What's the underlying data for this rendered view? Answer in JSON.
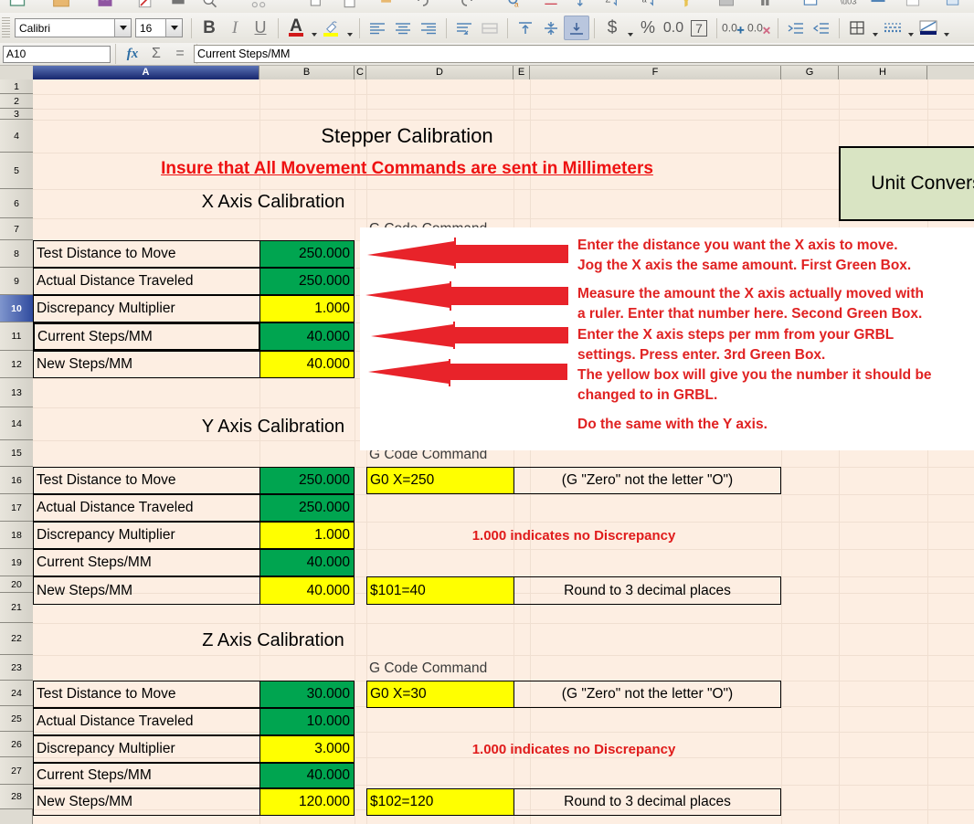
{
  "toolbar": {
    "font_name": "Calibri",
    "font_size": "16",
    "bold_label": "B",
    "italic_label": "I",
    "underline_label": "U",
    "font_color_label": "A",
    "highlight_label": "highlighting-color-icon",
    "currency_label": "$",
    "percent_label": "%",
    "number_label": "0.0",
    "date_label": "7",
    "add_decimal_label": "0.0+",
    "del_decimal_label": "0.0x",
    "icons": [
      "align-left-icon",
      "align-center-icon",
      "align-right-icon",
      "align-justified-icon",
      "wrap-text-icon",
      "merge-cells-icon",
      "align-top-icon",
      "center-vertically-icon",
      "align-bottom-icon",
      "increase-indent-icon",
      "decrease-indent-icon",
      "borders-icon",
      "border-style-icon",
      "border-color-icon"
    ]
  },
  "formula_bar": {
    "name_box": "A10",
    "function_wizard": "fx",
    "sum_icon": "Σ",
    "formula_icon": "=",
    "input_line": "Current Steps/MM"
  },
  "grid": {
    "columns": [
      {
        "label": "A",
        "selected": true
      },
      {
        "label": "B",
        "selected": false
      },
      {
        "label": "C",
        "selected": false
      },
      {
        "label": "D",
        "selected": false
      },
      {
        "label": "E",
        "selected": false
      },
      {
        "label": "F",
        "selected": false
      },
      {
        "label": "G",
        "selected": false
      },
      {
        "label": "H",
        "selected": false
      }
    ],
    "rows": [
      {
        "label": "1"
      },
      {
        "label": "2"
      },
      {
        "label": "3"
      },
      {
        "label": "4"
      },
      {
        "label": "5"
      },
      {
        "label": "6"
      },
      {
        "label": "7"
      },
      {
        "label": "8"
      },
      {
        "label": "9"
      },
      {
        "label": "10",
        "selected": true
      },
      {
        "label": "11"
      },
      {
        "label": "12"
      },
      {
        "label": "13"
      },
      {
        "label": "14"
      },
      {
        "label": "15"
      },
      {
        "label": "16"
      },
      {
        "label": "17"
      },
      {
        "label": "18"
      },
      {
        "label": "19"
      },
      {
        "label": "20"
      },
      {
        "label": "21"
      },
      {
        "label": "22"
      },
      {
        "label": "23"
      },
      {
        "label": "24"
      },
      {
        "label": "25"
      },
      {
        "label": "26"
      },
      {
        "label": "27"
      },
      {
        "label": "28"
      }
    ]
  },
  "sheet": {
    "heading_main": "Stepper Calibration",
    "warning": "Insure that All Movement Commands are sent in Millimeters",
    "unit_conversion_title": "Unit Conversion",
    "sections": [
      {
        "title": "X Axis Calibration",
        "gcode_header": "G Code Command",
        "rows": [
          {
            "label": "Test Distance to Move",
            "value": "250.000",
            "fill": "green"
          },
          {
            "label": "Actual Distance Traveled",
            "value": "250.000",
            "fill": "green"
          },
          {
            "label": "Discrepancy Multiplier",
            "value": "1.000",
            "fill": "yellow"
          },
          {
            "label": "Current Steps/MM",
            "value": "40.000",
            "fill": "green"
          },
          {
            "label": "New Steps/MM",
            "value": "40.000",
            "fill": "yellow"
          }
        ]
      },
      {
        "title": "Y Axis Calibration",
        "gcode_header": "G Code Command",
        "gcode_move": "G0 X=250",
        "gcode_move_note": "(G \"Zero\" not the letter \"O\")",
        "discrepancy_note": "1.000 indicates no Discrepancy",
        "gcode_set": "$101=40",
        "gcode_set_note": "Round to 3 decimal places",
        "rows": [
          {
            "label": "Test Distance to Move",
            "value": "250.000",
            "fill": "green"
          },
          {
            "label": "Actual Distance Traveled",
            "value": "250.000",
            "fill": "green"
          },
          {
            "label": "Discrepancy Multiplier",
            "value": "1.000",
            "fill": "yellow"
          },
          {
            "label": "Current Steps/MM",
            "value": "40.000",
            "fill": "green"
          },
          {
            "label": "New Steps/MM",
            "value": "40.000",
            "fill": "yellow"
          }
        ]
      },
      {
        "title": "Z Axis Calibration",
        "gcode_header": "G Code Command",
        "gcode_move": "G0 X=30",
        "gcode_move_note": "(G \"Zero\" not the letter \"O\")",
        "discrepancy_note": "1.000 indicates no Discrepancy",
        "gcode_set": "$102=120",
        "gcode_set_note": "Round to 3 decimal places",
        "rows": [
          {
            "label": "Test Distance to Move",
            "value": "30.000",
            "fill": "green"
          },
          {
            "label": "Actual Distance Traveled",
            "value": "10.000",
            "fill": "green"
          },
          {
            "label": "Discrepancy Multiplier",
            "value": "3.000",
            "fill": "yellow"
          },
          {
            "label": "Current Steps/MM",
            "value": "40.000",
            "fill": "green"
          },
          {
            "label": "New Steps/MM",
            "value": "120.000",
            "fill": "yellow"
          }
        ]
      }
    ]
  },
  "callout": {
    "lines": [
      "Enter the distance you want the X axis to move.",
      "Jog the X axis the same amount. First Green Box.",
      "Measure the amount the X axis actually moved with",
      "a ruler. Enter that number here. Second Green Box.",
      "Enter the X axis steps per mm from your GRBL",
      "settings. Press enter. 3rd Green Box.",
      "The yellow box will give you the number it should be",
      "changed to in GRBL.",
      "Do the same with the Y axis."
    ],
    "arrow_count": 4,
    "arrow_color": "#e8232a"
  },
  "colors": {
    "sheet_bg": "#fdeee2",
    "green_fill": "#00a550",
    "yellow_fill": "#ffff00",
    "red_text": "#e01b1b",
    "unit_box_fill": "#d9e4c3",
    "selection_blue": "#2f4a9e"
  }
}
